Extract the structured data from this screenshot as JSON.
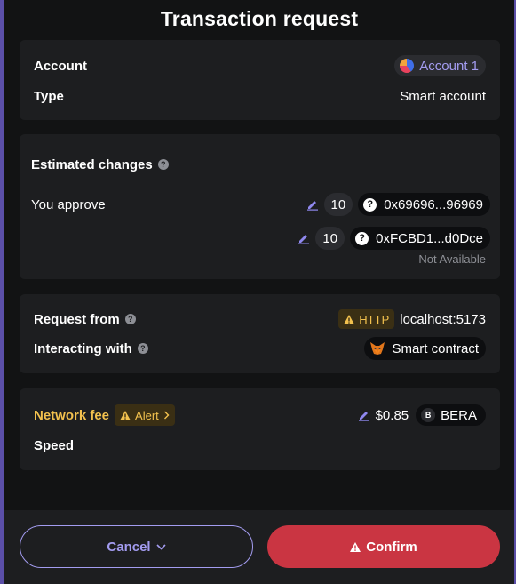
{
  "header": {
    "title": "Transaction request"
  },
  "account_card": {
    "account_label": "Account",
    "account_value": "Account 1",
    "type_label": "Type",
    "type_value": "Smart account"
  },
  "changes_card": {
    "title": "Estimated changes",
    "approve_label": "You approve",
    "approvals": [
      {
        "amount": "10",
        "address": "0x69696...96969"
      },
      {
        "amount": "10",
        "address": "0xFCBD1...d0Dce",
        "note": "Not Available"
      }
    ]
  },
  "request_card": {
    "request_from_label": "Request from",
    "protocol_badge": "HTTP",
    "origin": "localhost:5173",
    "interacting_label": "Interacting with",
    "contract": "Smart contract"
  },
  "fee_card": {
    "network_fee_label": "Network fee",
    "alert_label": "Alert",
    "fee_value": "$0.85",
    "token": "BERA",
    "token_initial": "B",
    "speed_label": "Speed"
  },
  "footer": {
    "cancel_label": "Cancel",
    "confirm_label": "Confirm"
  },
  "colors": {
    "accent": "#a39cf0",
    "warning": "#f2c14e",
    "danger": "#ca3542",
    "background": "#121314",
    "card": "#1d1e20"
  }
}
